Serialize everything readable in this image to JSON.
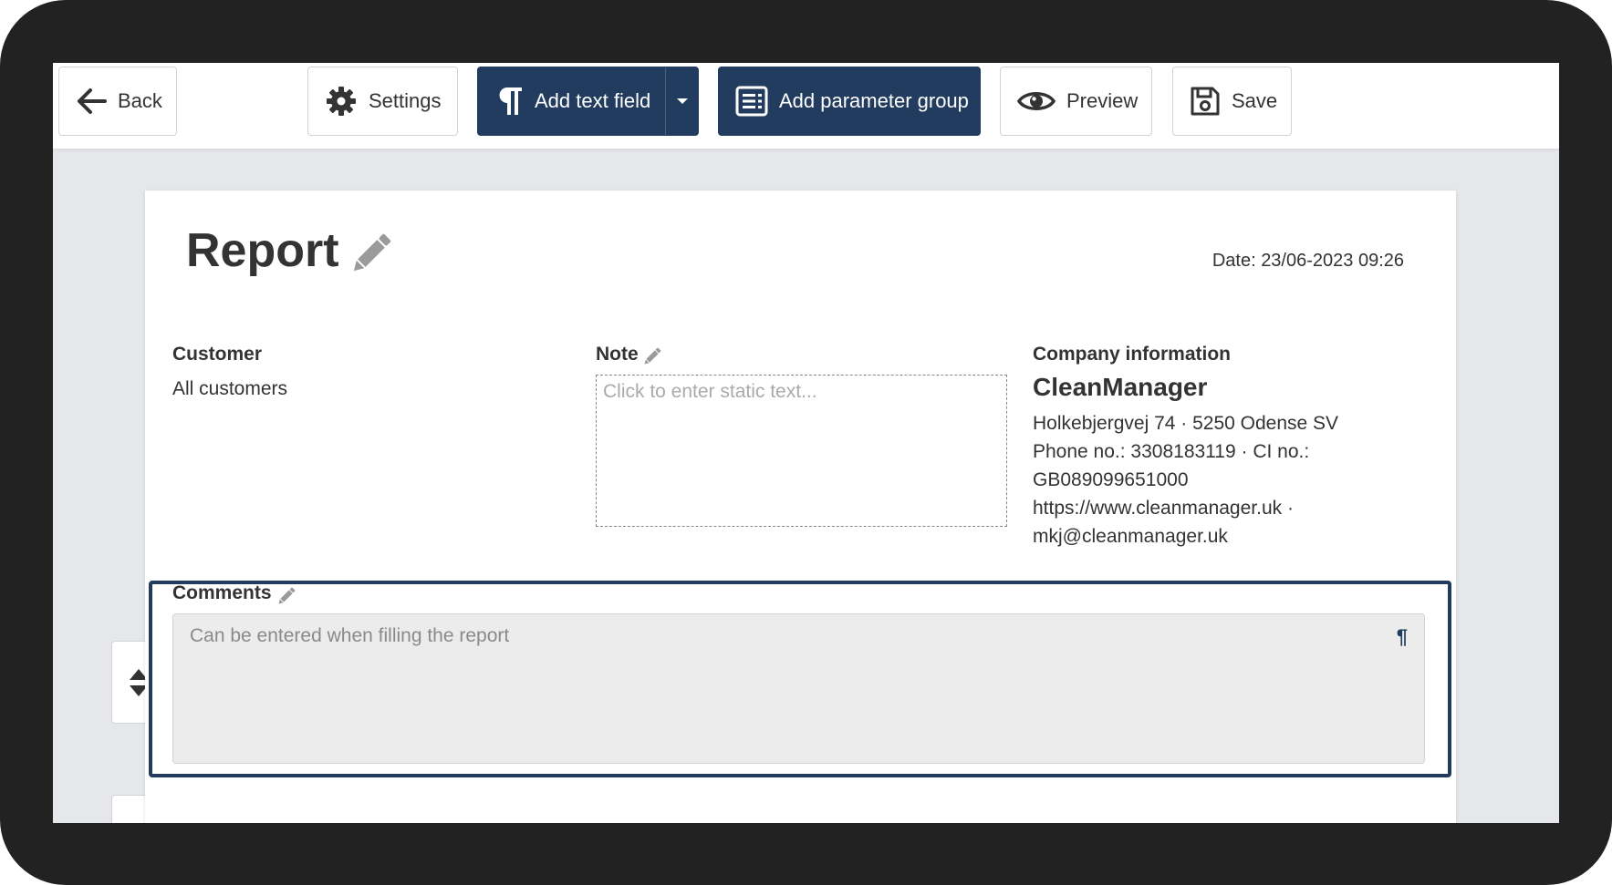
{
  "toolbar": {
    "back_label": "Back",
    "settings_label": "Settings",
    "add_text_field_label": "Add text field",
    "add_parameter_group_label": "Add parameter group",
    "preview_label": "Preview",
    "save_label": "Save",
    "icons": [
      "arrow-left-icon",
      "gear-icon",
      "paragraph-icon",
      "caret-down-icon",
      "list-box-icon",
      "eye-icon",
      "floppy-disk-icon"
    ]
  },
  "report": {
    "title": "Report",
    "date": "Date: 23/06-2023 09:26"
  },
  "customer": {
    "title": "Customer",
    "value": "All customers"
  },
  "note": {
    "title": "Note",
    "placeholder": "Click to enter static text..."
  },
  "company": {
    "title": "Company information",
    "name": "CleanManager",
    "lines": [
      "Holkebjergvej 74 · 5250 Odense SV",
      "Phone no.: 3308183119 · CI no.:",
      "GB089099651000",
      "https://www.cleanmanager.uk ·",
      "mkj@cleanmanager.uk"
    ]
  },
  "comments": {
    "title": "Comments",
    "placeholder": "Can be entered when filling the report",
    "field_icon": "¶"
  },
  "colors": {
    "accent": "#213c5e",
    "frame": "#222222",
    "canvas": "#e5e7ea"
  }
}
